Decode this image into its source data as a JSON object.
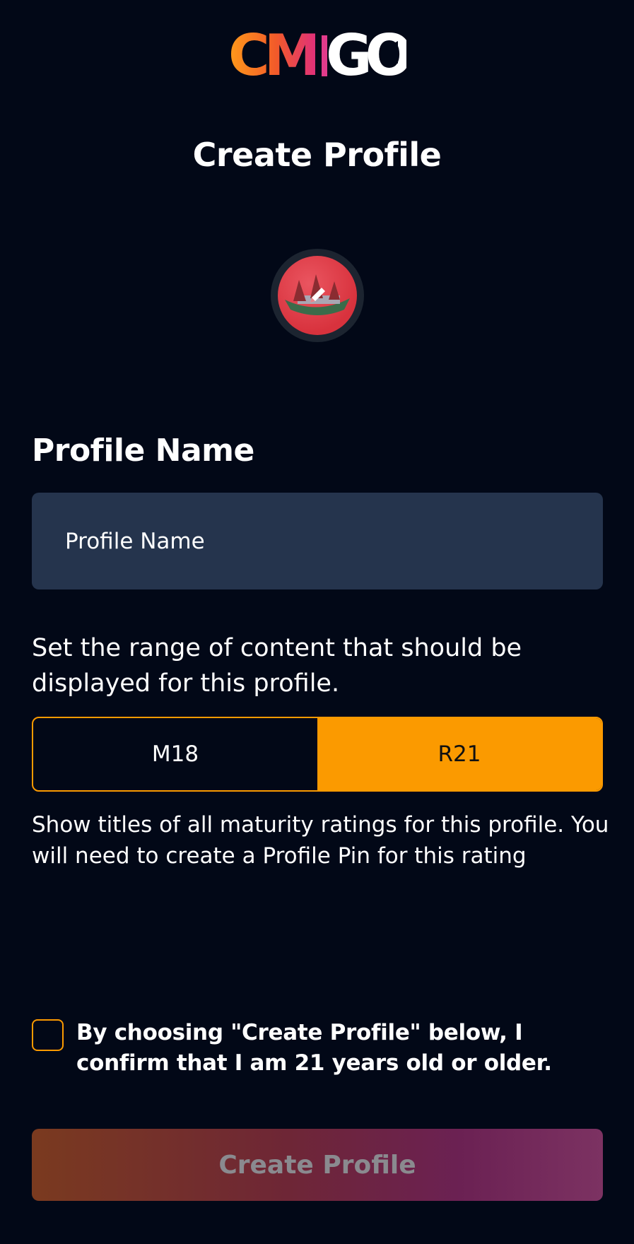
{
  "logo": {
    "text": "CMGO"
  },
  "header": {
    "title": "Create Profile"
  },
  "avatar": {
    "icon": "pencil-edit-icon"
  },
  "profile_name": {
    "label": "Profile Name",
    "placeholder": "Profile Name",
    "value": ""
  },
  "content_range": {
    "description": "Set the range of content that should be displayed for this profile.",
    "options": [
      "M18",
      "R21"
    ],
    "selected": "R21",
    "help": "Show titles of all maturity ratings for this profile. You will need to create a Profile Pin for this rating"
  },
  "confirm": {
    "checked": false,
    "text": "By choosing \"Create Profile\" below, I confirm that I am 21 years old or older."
  },
  "cta": {
    "label": "Create Profile"
  },
  "colors": {
    "background": "#020817",
    "accent": "#fb9a00",
    "input_bg": "#25344d"
  }
}
